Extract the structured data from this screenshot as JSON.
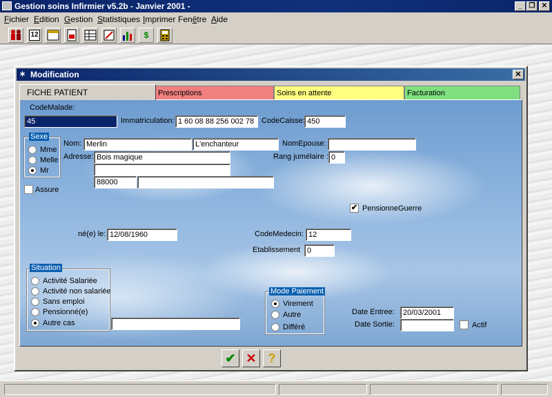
{
  "window": {
    "title": "Gestion soins Infirmier v5.2b - Janvier 2001 -",
    "minimize_label": "_",
    "maximize_label": "❐",
    "close_label": "✕"
  },
  "menu": [
    {
      "pre": "",
      "u": "F",
      "post": "ichier"
    },
    {
      "pre": "",
      "u": "E",
      "post": "dition"
    },
    {
      "pre": "",
      "u": "G",
      "post": "estion"
    },
    {
      "pre": "",
      "u": "S",
      "post": "tatistiques"
    },
    {
      "pre": "",
      "u": "I",
      "post": "mprimer"
    },
    {
      "pre": "Fen",
      "u": "ê",
      "post": "tre"
    },
    {
      "pre": "",
      "u": "A",
      "post": "ide"
    }
  ],
  "toolbar": {
    "calendar_text": "12",
    "money_text": "$"
  },
  "dialog": {
    "title": "Modification",
    "close_label": "✕",
    "tabs": [
      "FICHE PATIENT",
      "Prescriptions",
      "Soins en attente",
      "Facturation"
    ],
    "tab_colors": [
      "#d4d0c8",
      "#f08080",
      "#ffff80",
      "#80e080"
    ]
  },
  "form": {
    "codemalade_label": "CodeMalade:",
    "codemalade": "45",
    "immat_label": "Immatriculation:",
    "immat": "1 60 08 88 256 002 78",
    "codecaisse_label": "CodeCaisse:",
    "codecaisse": "450",
    "sexe_label": "Sexe",
    "sexe_options": [
      "Mme",
      "Melle",
      "Mr"
    ],
    "nom_label": "Nom:",
    "nom": "Merlin",
    "prenom": "L'enchanteur",
    "nomepouse_label": "NomEpouse:",
    "nomepouse": "",
    "adresse_label": "Adresse:",
    "adresse1": "Bois magique",
    "adresse2": "",
    "cp": "88000",
    "ville": "",
    "rang_label": "Rang jumélaire :",
    "rang": "0",
    "assure_label": "Assure",
    "pension_label": "PensionneGuerre",
    "pension_mark": "✔",
    "ne_label": "né(e) le:",
    "ne": "12/08/1960",
    "codemedecin_label": "CodeMedecin:",
    "codemedecin": "12",
    "etab_label": "Etablissement",
    "etab": "0",
    "situation_label": "Situation",
    "situation_options": [
      "Activité Salariée",
      "Activité non salariée",
      "Sans emploi",
      "Pensionné(e)",
      "Autre cas"
    ],
    "autrecas_value": "",
    "modepaiement_label": "Mode Paiement",
    "paiement_options": [
      "Virement",
      "Autre",
      "Différé"
    ],
    "date_entree_label": "Date Entree:",
    "date_entree": "20/03/2001",
    "date_sortie_label": "Date Sortie:",
    "date_sortie": "",
    "actif_label": "Actif"
  },
  "buttons": {
    "ok": "✔",
    "cancel": "✕",
    "help": "?"
  }
}
